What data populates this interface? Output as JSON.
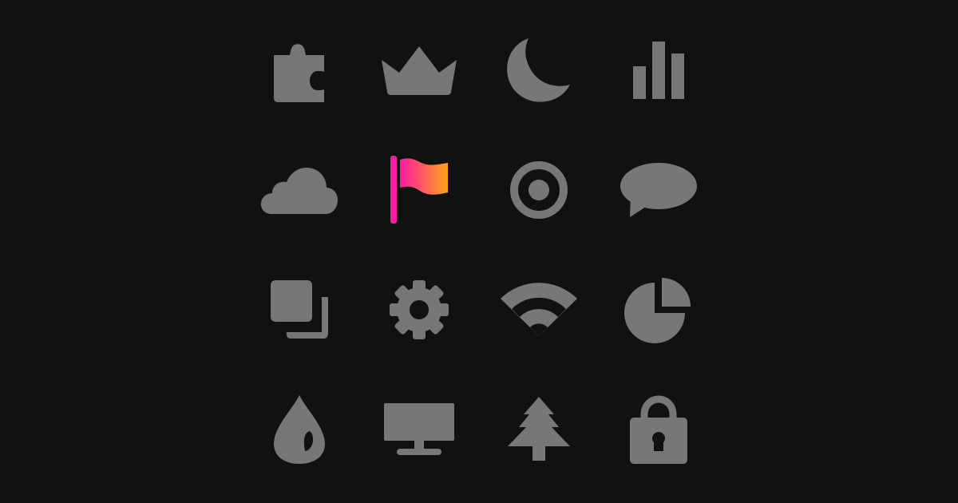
{
  "colors": {
    "background": "#111111",
    "icon": "#777777",
    "accent_start": "#ff1aa3",
    "accent_end": "#ffa319"
  },
  "icons": [
    {
      "name": "puzzle-piece-icon",
      "highlighted": false
    },
    {
      "name": "crown-icon",
      "highlighted": false
    },
    {
      "name": "moon-icon",
      "highlighted": false
    },
    {
      "name": "bar-chart-icon",
      "highlighted": false
    },
    {
      "name": "cloud-icon",
      "highlighted": false
    },
    {
      "name": "flag-icon",
      "highlighted": true
    },
    {
      "name": "target-icon",
      "highlighted": false
    },
    {
      "name": "speech-bubble-icon",
      "highlighted": false
    },
    {
      "name": "copy-layers-icon",
      "highlighted": false
    },
    {
      "name": "gear-icon",
      "highlighted": false
    },
    {
      "name": "wifi-icon",
      "highlighted": false
    },
    {
      "name": "pie-chart-icon",
      "highlighted": false
    },
    {
      "name": "water-drop-icon",
      "highlighted": false
    },
    {
      "name": "monitor-icon",
      "highlighted": false
    },
    {
      "name": "pine-tree-icon",
      "highlighted": false
    },
    {
      "name": "lock-icon",
      "highlighted": false
    }
  ]
}
